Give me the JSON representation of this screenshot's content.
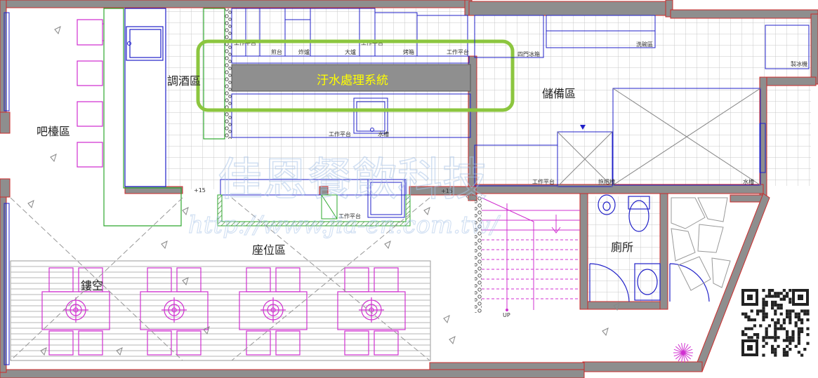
{
  "zones": {
    "bar": "吧檯區",
    "bartending": "調酒區",
    "storage": "儲備區",
    "seating": "座位區",
    "void": "鏤空",
    "restroom": "廁所"
  },
  "highlight": {
    "label": "汙水處理系統",
    "color": "#8cc63f"
  },
  "kitchen_labels": {
    "work_counter": "工作平台",
    "fryer": "煎台",
    "griddle": "炸爐",
    "wok_stove": "大爐",
    "oven": "烤箱",
    "fridge_4door": "四門冰箱",
    "dishwasher": "洗碗區",
    "ice_maker": "製冰機",
    "sink": "水槽",
    "mop_sink": "拖把槽"
  },
  "level_marks": {
    "left": "+15",
    "right": "+15"
  },
  "stair_label": "UP",
  "watermark": {
    "text": "佳恩餐飲科技",
    "url": "http://www.jia-en.com.tw/"
  },
  "colors": {
    "wall": "#8e8e8e",
    "wall_edge": "#cc2a2a",
    "grid": "#c8c8c8",
    "fixture": "#2020c8",
    "furniture": "#d030d0",
    "watermark": "#a9c4e8",
    "counter_fill": "#8f8f8f"
  }
}
